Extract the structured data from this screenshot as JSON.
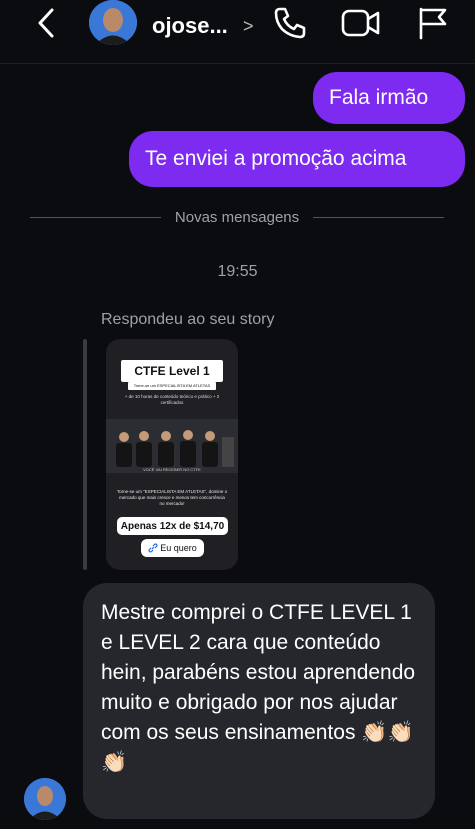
{
  "header": {
    "username": "ojose...",
    "icons": {
      "back": "chevron-left-icon",
      "chevron": "chevron-right-icon",
      "call": "phone-icon",
      "video": "video-camera-icon",
      "flag": "flag-icon"
    },
    "chevron_glyph": ">"
  },
  "messages": {
    "outgoing": [
      "Fala irmão",
      "Te enviei a promoção acima"
    ],
    "divider": "Novas mensagens",
    "timestamp": "19:55",
    "story_reply_label": "Respondeu ao seu story",
    "incoming": "Mestre comprei o CTFE LEVEL 1 e LEVEL 2 cara que conteúdo hein, parabéns estou aprendendo muito e obrigado por nos ajudar com os seus ensinamentos 👏🏻👏🏻👏🏻"
  },
  "story": {
    "title": "CTFE Level 1",
    "subtitle": "Torne-se um ESPECIALISTA EM ATLETAS",
    "hours": "+ de 10 horas de conteúdo teórico e prático + 2 certificados",
    "tagline": "VOCÊ VAI RECEBER NO CTFE",
    "text": "Torne-se um \"ESPECIALISTA EM ATLETAS\", domine o mercado que mais cresce e menos tem concorrência no mercado!",
    "price": "Apenas 12x de $14,70",
    "button": "Eu quero"
  },
  "colors": {
    "background": "#0b0c10",
    "outgoing_bubble": "#7d2bf0",
    "incoming_bubble": "#26272c",
    "muted_text": "#a0a0a6"
  }
}
